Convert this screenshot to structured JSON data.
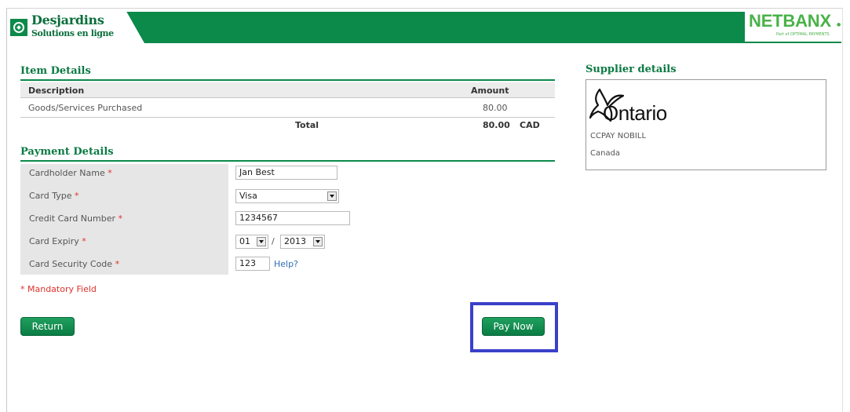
{
  "header": {
    "brand_name": "Desjardins",
    "brand_tagline": "Solutions en ligne",
    "partner_name": "NETBANX",
    "partner_tagline": "Part of OPTIMAL PAYMENTS"
  },
  "item_details": {
    "title": "Item Details",
    "columns": {
      "description": "Description",
      "amount": "Amount"
    },
    "rows": [
      {
        "description": "Goods/Services Purchased",
        "amount": "80.00"
      }
    ],
    "total_label": "Total",
    "total_amount": "80.00",
    "currency": "CAD"
  },
  "payment_details": {
    "title": "Payment Details",
    "required_mark": "*",
    "fields": {
      "cardholder_name": {
        "label": "Cardholder Name",
        "value": "Jan Best"
      },
      "card_type": {
        "label": "Card Type",
        "value": "Visa"
      },
      "card_number": {
        "label": "Credit Card Number",
        "value": "1234567"
      },
      "card_expiry": {
        "label": "Card Expiry",
        "month": "01",
        "separator": "/",
        "year": "2013"
      },
      "security_code": {
        "label": "Card Security Code",
        "value": "123",
        "help": "Help?"
      }
    },
    "mandatory_note": "* Mandatory Field"
  },
  "buttons": {
    "return": "Return",
    "pay_now": "Pay Now"
  },
  "supplier": {
    "title": "Supplier details",
    "logo_text": "Ontario",
    "name": "CCPAY NOBILL",
    "country": "Canada"
  },
  "colors": {
    "brand_green": "#0b8a4a",
    "partner_green": "#49b248",
    "required_red": "#e0312a",
    "highlight_blue": "#3a40c8",
    "link_blue": "#2f6db7"
  }
}
